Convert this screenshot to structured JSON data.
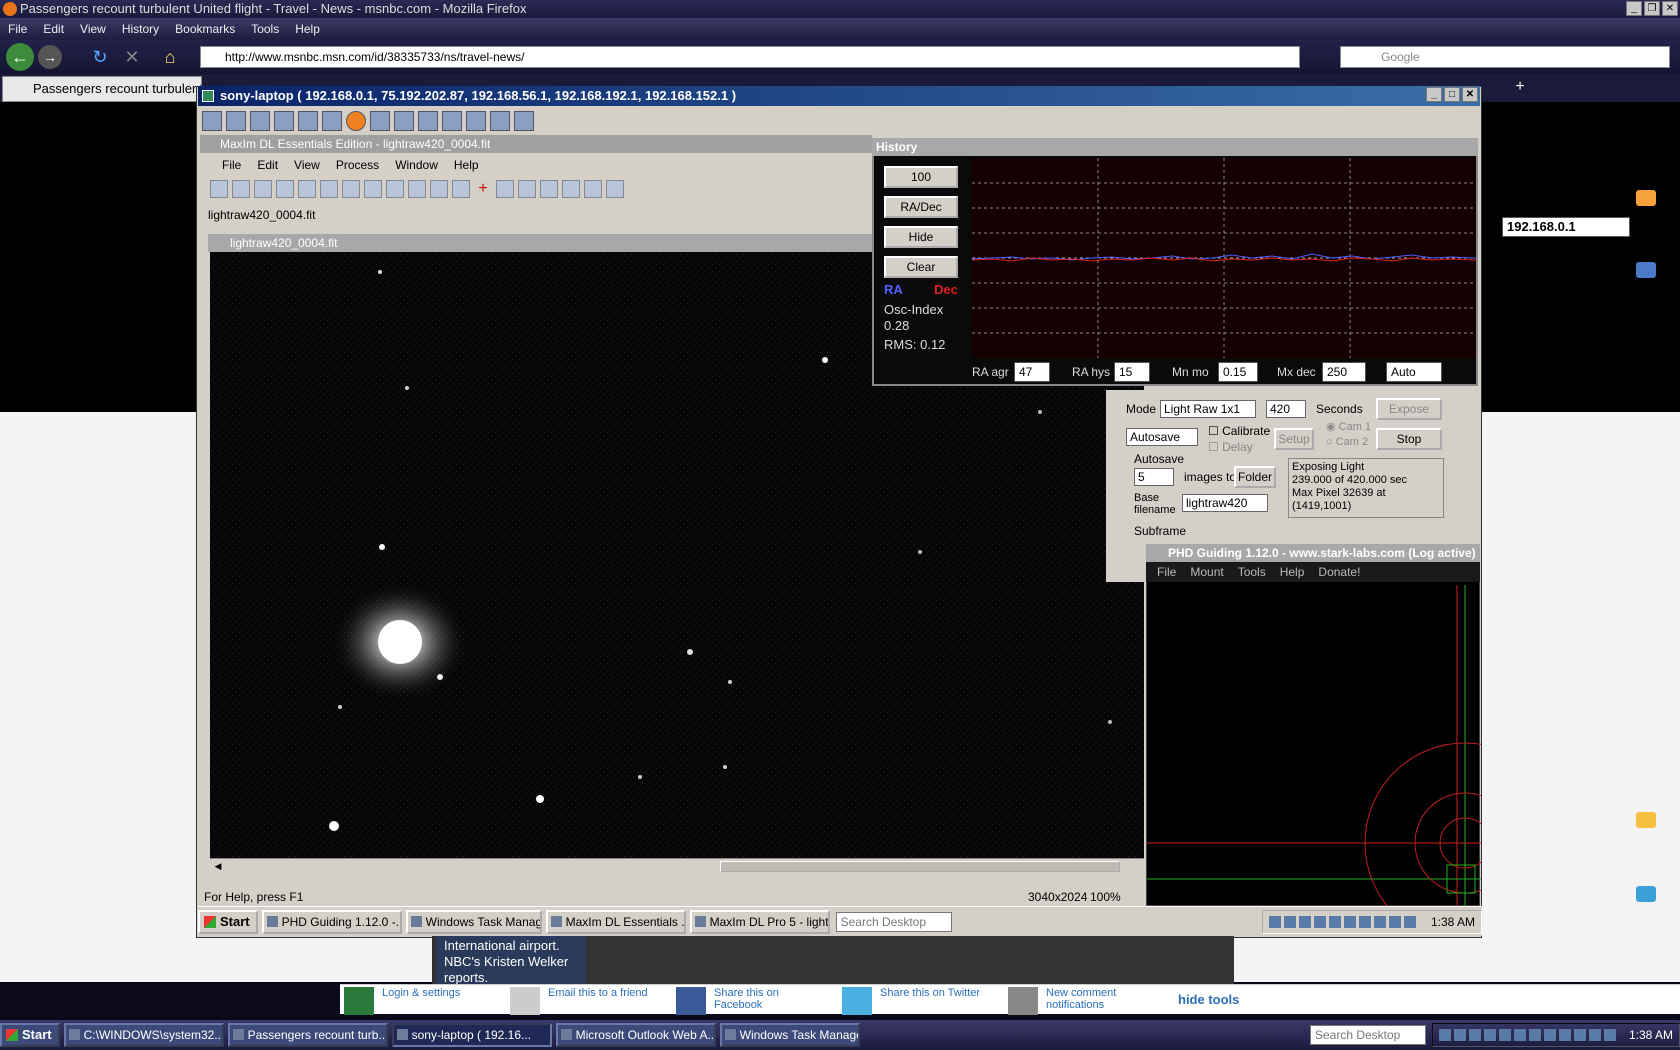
{
  "firefox": {
    "window_title": "Passengers recount turbulent United flight - Travel - News - msnbc.com - Mozilla Firefox",
    "menu": [
      "File",
      "Edit",
      "View",
      "History",
      "Bookmarks",
      "Tools",
      "Help"
    ],
    "url": "http://www.msnbc.msn.com/id/38335733/ns/travel-news/",
    "search_placeholder": "Google",
    "tab_label": "Passengers recount turbulent..."
  },
  "remote": {
    "title": "sony-laptop ( 192.168.0.1, 75.192.202.87, 192.168.56.1, 192.168.192.1, 192.168.152.1 )",
    "ip": "192.168.0.1"
  },
  "maxim": {
    "title": "MaxIm DL Essentials Edition - lightraw420_0004.fit",
    "menu": [
      "File",
      "Edit",
      "View",
      "Process",
      "Window",
      "Help"
    ],
    "doc_tab": "lightraw420_0004.fit",
    "image_title": "lightraw420_0004.fit",
    "status_help": "For Help, press F1",
    "status_dims": "3040x2024",
    "status_zoom": "100%"
  },
  "history": {
    "title": "History",
    "btn_100": "100",
    "btn_radec": "RA/Dec",
    "btn_hide": "Hide",
    "btn_clear": "Clear",
    "ra": "RA",
    "dec": "Dec",
    "osc_label": "Osc-Index",
    "osc_value": "0.28",
    "rms": "RMS: 0.12",
    "ra_agr_label": "RA agr",
    "ra_agr": "47",
    "ra_hys_label": "RA hys",
    "ra_hys": "15",
    "mn_mo_label": "Mn mo",
    "mn_mo": "0.15",
    "mx_dec_label": "Mx dec",
    "mx_dec": "250",
    "mode": "Auto",
    "colors": {
      "ra": "#4a5cff",
      "dec": "#e02020"
    }
  },
  "camera": {
    "mode_label": "Mode",
    "mode_value": "Light Raw 1x1",
    "seconds_value": "420",
    "seconds_label": "Seconds",
    "expose": "Expose",
    "autosave_select": "Autosave",
    "calibrate": "Calibrate",
    "delay": "Delay",
    "setup": "Setup",
    "cam1": "Cam 1",
    "cam2": "Cam 2",
    "stop": "Stop",
    "autosave_group": "Autosave",
    "count": "5",
    "images_to": "images to",
    "folder": "Folder",
    "base_filename_label": "Base filename",
    "base_filename": "lightraw420",
    "status_lines": [
      "Exposing Light",
      "239.000 of 420.000 sec",
      "Max Pixel 32639 at",
      "(1419,1001)"
    ],
    "subframe": "Subframe"
  },
  "phd": {
    "title": "PHD Guiding 1.12.0  -  www.stark-labs.com (Log active)",
    "menu": [
      "File",
      "Mount",
      "Tools",
      "Help",
      "Donate!"
    ]
  },
  "inner_taskbar": {
    "start": "Start",
    "items": [
      "PHD Guiding 1.12.0 -...",
      "Windows Task Manager",
      "MaxIm DL Essentials ...",
      "MaxIm DL Pro 5 - light..."
    ],
    "search": "Search Desktop",
    "time": "1:38 AM"
  },
  "page": {
    "news_text": "International airport. NBC's Kristen Welker reports.",
    "share_items": [
      "Login & settings",
      "Email this to a friend",
      "Share this on Facebook",
      "Share this on Twitter",
      "New comment notifications"
    ],
    "hide_tools": "hide tools"
  },
  "outer_taskbar": {
    "start": "Start",
    "items": [
      "C:\\WINDOWS\\system32...",
      "Passengers recount turb...",
      "sony-laptop ( 192.16...",
      "Microsoft Outlook Web A...",
      "Windows Task Manager"
    ],
    "search": "Search Desktop",
    "time": "1:38 AM"
  }
}
